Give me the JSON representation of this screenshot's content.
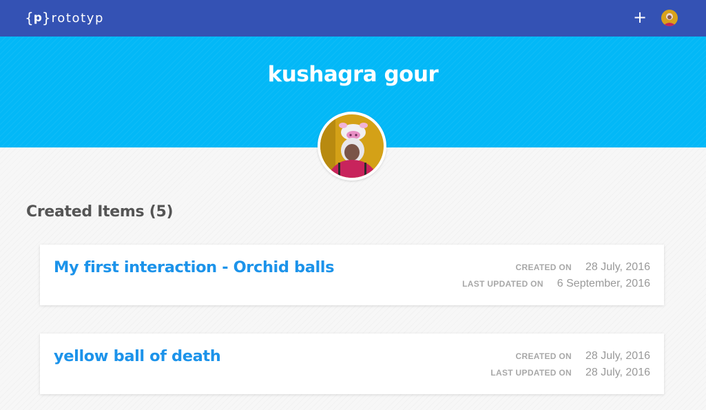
{
  "header": {
    "logo_text": "rototyp",
    "logo_mark_letter": "p",
    "logo_braces": [
      "{",
      "}"
    ],
    "add_label": "+",
    "icons": {
      "logo": "prototyp-logo-icon",
      "add": "plus-icon",
      "user": "user-avatar"
    }
  },
  "profile": {
    "name": "kushagra gour"
  },
  "section": {
    "title": "Created Items (5)"
  },
  "items": [
    {
      "title": "My first interaction - Orchid balls",
      "created_label": "CREATED ON",
      "created_value": "28 July, 2016",
      "updated_label": "LAST UPDATED ON",
      "updated_value": "6 September, 2016"
    },
    {
      "title": "yellow ball of death",
      "created_label": "CREATED ON",
      "created_value": "28 July, 2016",
      "updated_label": "LAST UPDATED ON",
      "updated_value": "28 July, 2016"
    }
  ],
  "colors": {
    "topbar": "#3452b4",
    "hero": "#03b8f7",
    "card_title": "#1c93ea",
    "section_title": "#555555",
    "meta_label": "#a8a8a8",
    "meta_value": "#999999"
  }
}
